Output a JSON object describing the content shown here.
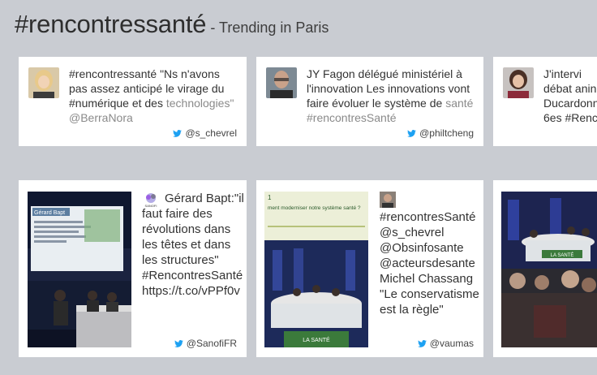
{
  "header": {
    "hashtag": "#rencontressanté",
    "subtitle": " - Trending in Paris"
  },
  "tweets_top": [
    {
      "text_main": "#rencontressanté \"Ns n'avons pas assez anticipé le virage du #numérique et des",
      "text_fade": "technologies\" @BerraNora",
      "handle": "@s_chevrel"
    },
    {
      "text_main": "JY Fagon délégué ministériel à l'innovation Les innovations vont faire évoluer le système de",
      "text_fade": "santé #rencontresSanté",
      "handle": "@philtcheng"
    },
    {
      "text_main": "J'intervi débat anin Ducardonn 6es #Renc",
      "handle": ""
    }
  ],
  "tweets_bottom": [
    {
      "text": "Gérard Bapt:\"il faut faire des révolutions dans les têtes et dans les structures\" #RencontresSanté https://t.co/vPPf0v",
      "handle": "@SanofiFR",
      "slide_title": "Gérard Bapt",
      "brand": "SANOFI"
    },
    {
      "text": "#rencontresSanté @s_chevrel @Obsinfosante @acteursdesante Michel Chassang \"Le conservatisme est la règle\"",
      "handle": "@vaumas",
      "slide_title": "ment moderniser notre système santé ?",
      "slide_num": "1",
      "banner": "LA SANTÉ"
    },
    {
      "text": "",
      "handle": "",
      "banner": "LA SANTÉ"
    }
  ],
  "colors": {
    "twitter": "#1da1f2",
    "background": "#c9ccd2"
  }
}
